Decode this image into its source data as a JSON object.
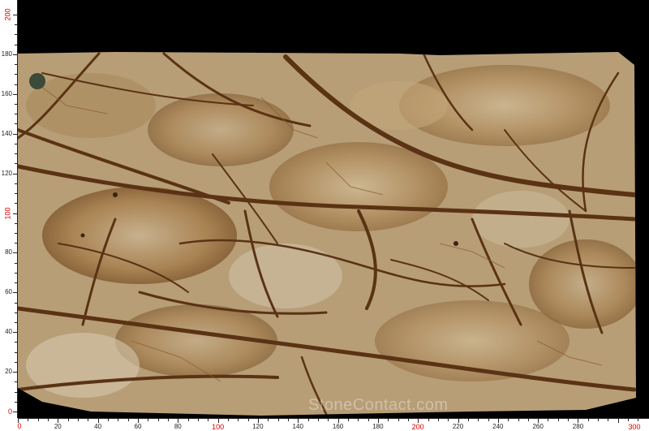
{
  "photo": {
    "subject": "brown-marble-slab",
    "background_color": "#000000",
    "stone_base_color": "#b8a07a",
    "vein_color": "#5a3214",
    "watermark_text": "StoneContact.com"
  },
  "ruler_left": {
    "labels": [
      {
        "text": "200",
        "value": 200,
        "color": "#d40000"
      },
      {
        "text": "180",
        "value": 180,
        "color": "#222222"
      },
      {
        "text": "160",
        "value": 160,
        "color": "#222222"
      },
      {
        "text": "140",
        "value": 140,
        "color": "#222222"
      },
      {
        "text": "120",
        "value": 120,
        "color": "#222222"
      },
      {
        "text": "100",
        "value": 100,
        "color": "#d40000"
      },
      {
        "text": "80",
        "value": 80,
        "color": "#222222"
      },
      {
        "text": "60",
        "value": 60,
        "color": "#222222"
      },
      {
        "text": "40",
        "value": 40,
        "color": "#222222"
      },
      {
        "text": "20",
        "value": 20,
        "color": "#222222"
      },
      {
        "text": "0",
        "value": 0,
        "color": "#d40000"
      }
    ]
  },
  "ruler_bottom": {
    "labels": [
      {
        "text": "20",
        "value": 20,
        "color": "#222222"
      },
      {
        "text": "40",
        "value": 40,
        "color": "#222222"
      },
      {
        "text": "60",
        "value": 60,
        "color": "#222222"
      },
      {
        "text": "80",
        "value": 80,
        "color": "#222222"
      },
      {
        "text": "100",
        "value": 100,
        "color": "#d40000"
      },
      {
        "text": "120",
        "value": 120,
        "color": "#222222"
      },
      {
        "text": "140",
        "value": 140,
        "color": "#222222"
      },
      {
        "text": "160",
        "value": 160,
        "color": "#222222"
      },
      {
        "text": "180",
        "value": 180,
        "color": "#222222"
      },
      {
        "text": "200",
        "value": 200,
        "color": "#d40000"
      },
      {
        "text": "220",
        "value": 220,
        "color": "#222222"
      },
      {
        "text": "240",
        "value": 240,
        "color": "#222222"
      },
      {
        "text": "260",
        "value": 260,
        "color": "#222222"
      },
      {
        "text": "280",
        "value": 280,
        "color": "#222222"
      },
      {
        "text": "300",
        "value": 300,
        "color": "#d40000"
      }
    ]
  }
}
